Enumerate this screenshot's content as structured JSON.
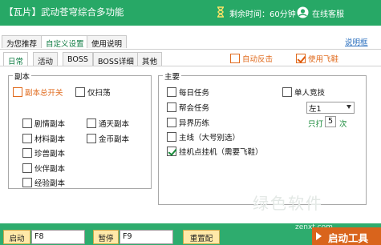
{
  "window": {
    "title": "【瓦片】武动苍穹综合多功能",
    "timer_label": "剩余时间：60分钟",
    "service_label": "在线客服"
  },
  "tabs_top": [
    "为您推荐",
    "自定义设置",
    "使用说明"
  ],
  "top_link": "说明框",
  "tabs_sub": [
    "日常",
    "活动",
    "BOSS",
    "BOSS详细",
    "其他"
  ],
  "options_right": {
    "auto_counter": "自动反击",
    "use_flyshoe": "使用飞鞋"
  },
  "dungeon": {
    "group_label": "副本",
    "master_switch": "副本总开关",
    "sweep_only": "仅扫荡",
    "items_col1": [
      "剧情副本",
      "材料副本",
      "珍兽副本",
      "伙伴副本",
      "经验副本"
    ],
    "items_col2": [
      "通天副本",
      "金币副本"
    ]
  },
  "main_quest": {
    "group_label": "主要",
    "items": [
      "每日任务",
      "帮会任务",
      "异界历练",
      "主线（大号别选）",
      "挂机点挂机（需要飞鞋）"
    ],
    "solo": "单人竞技",
    "direction_value": "左1",
    "only_label": "只打",
    "only_count": "5",
    "only_unit": "次"
  },
  "bottom": {
    "start_label": "启动",
    "start_hotkey": "F8",
    "pause_label": "暂停",
    "pause_hotkey": "F9",
    "reset_label": "重置配置",
    "launch_label": "启动工具",
    "watermark_site": "zenxt.com"
  },
  "watermark": "绿色软件",
  "colors": {
    "title_bar": "#27a866",
    "accent_orange": "#e06b1e",
    "accent_green": "#198a3a",
    "launch_button": "#d9641c",
    "hotkey_button": "#ffe9a8"
  }
}
